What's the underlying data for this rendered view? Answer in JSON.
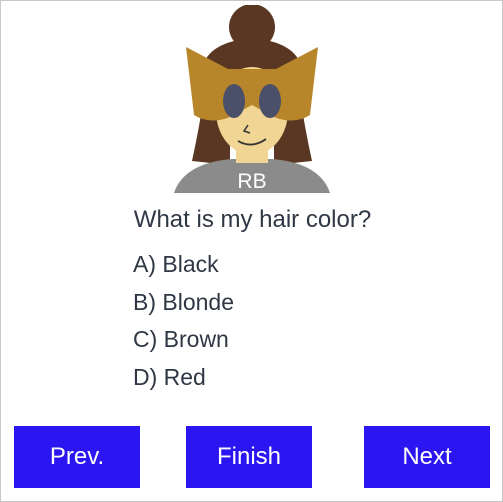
{
  "avatar": {
    "initials": "RB",
    "icon": "user-avatar-icon"
  },
  "quiz": {
    "question": "What is my hair color?",
    "options": [
      "A) Black",
      "B) Blonde",
      "C) Brown",
      "D) Red"
    ]
  },
  "nav": {
    "prev_label": "Prev.",
    "finish_label": "Finish",
    "next_label": "Next"
  },
  "colors": {
    "button": "#2b15f0",
    "text": "#2f3745",
    "hair": "#5a3722",
    "mask": "#b8862a",
    "skin": "#f0d595",
    "shirt": "#8b8b8b"
  }
}
